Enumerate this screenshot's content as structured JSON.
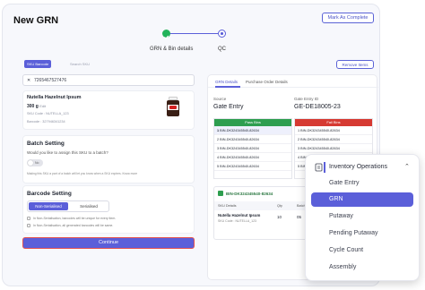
{
  "page": {
    "title": "New GRN",
    "mark_complete": "Mark As Complete"
  },
  "stepper": {
    "step1": "GRN & Bin details",
    "step2": "QC"
  },
  "left": {
    "tab_active": "SKU Barcode",
    "tab_inactive": "Search SKU",
    "barcode_value": "7265467527476",
    "product": {
      "name": "Nutella Hazelnut Ipsum",
      "qty": "300 g",
      "qty_unit": "Edit",
      "sku": "SKU Code : NUTELLA_123",
      "barcode": "Barcode : 327946341234"
    },
    "batch": {
      "heading": "Batch Setting",
      "question": "Would you like to assign this SKU to a batch?",
      "toggle": "No",
      "note": "Making this SKU a part of a batch will let you know when a SKU expires. Know more"
    },
    "barcode_setting": {
      "heading": "Barcode Setting",
      "opt1": "Non-Serialised",
      "opt2": "Serialised",
      "note1": "In Non-Serialisation, barcodes will be unique for every item.",
      "note2": "In Non-Serialisation, all generated barcodes will be same."
    },
    "continue": "Continue"
  },
  "right": {
    "remove": "Remove Items",
    "tab1": "GRN Details",
    "tab2": "Purchase Order Details",
    "source_label": "Source",
    "source_value": "Gate Entry",
    "gate_label": "Gate Entry ID",
    "gate_value": "GE-DE18005-23",
    "pass_head": "Pass Bins",
    "fail_head": "Fail Bins",
    "pass_rows": [
      "BIN-DK324345540-82634",
      "BIN-DK324345540-82634",
      "BIN-DK324345540-82634",
      "BIN-DK324345540-82634",
      "BIN-DK324345540-82634"
    ],
    "fail_rows": [
      "BIN-DK324345540-82634",
      "BIN-DK324345540-82634",
      "BIN-DK324345540-82634",
      "BIN-DK324345540-82634",
      "BIN-DK324345540-82634"
    ],
    "bin_tag": "BIN-DK324345540-82634",
    "table": {
      "headers": [
        "SKU Details",
        "Qty",
        "Batches"
      ],
      "name": "Nutella Hazelnut Ipsum",
      "code": "SKU Code : NUTELLA_123",
      "qty": "10",
      "batch": "05"
    }
  },
  "dropdown": {
    "heading": "Inventory Operations",
    "items": [
      "Gate Entry",
      "GRN",
      "Putaway",
      "Pending Putaway",
      "Cycle Count",
      "Assembly"
    ],
    "active_index": 1
  },
  "colors": {
    "accent": "#5b5fd9",
    "pass": "#2e9e4f",
    "fail": "#d63a32"
  }
}
